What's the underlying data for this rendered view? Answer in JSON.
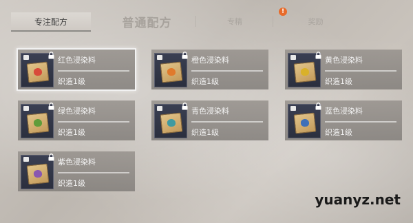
{
  "tabs": {
    "active": "专注配方",
    "big": "普通配方",
    "third": "专精",
    "fourth": "奖励",
    "badge": "!"
  },
  "recipes": [
    {
      "name": "红色浸染料",
      "level": "织造1级",
      "dye_color": "#d84a3a",
      "locked": true,
      "selected": true
    },
    {
      "name": "橙色浸染料",
      "level": "织造1级",
      "dye_color": "#e07a2c",
      "locked": true,
      "selected": false
    },
    {
      "name": "黄色浸染料",
      "level": "织造1级",
      "dye_color": "#d9b12a",
      "locked": true,
      "selected": false
    },
    {
      "name": "绿色浸染料",
      "level": "织造1级",
      "dye_color": "#5f9c3a",
      "locked": true,
      "selected": false
    },
    {
      "name": "青色浸染料",
      "level": "织造1级",
      "dye_color": "#3f9aa0",
      "locked": true,
      "selected": false
    },
    {
      "name": "蓝色浸染料",
      "level": "织造1级",
      "dye_color": "#3d6fb8",
      "locked": true,
      "selected": false
    },
    {
      "name": "紫色浸染料",
      "level": "织造1级",
      "dye_color": "#8a58b0",
      "locked": true,
      "selected": false
    }
  ],
  "watermark": "yuanyz.net",
  "icons": {
    "lock": "lock-icon",
    "recipe": "recipe-scroll-icon",
    "category": "category-icon"
  }
}
